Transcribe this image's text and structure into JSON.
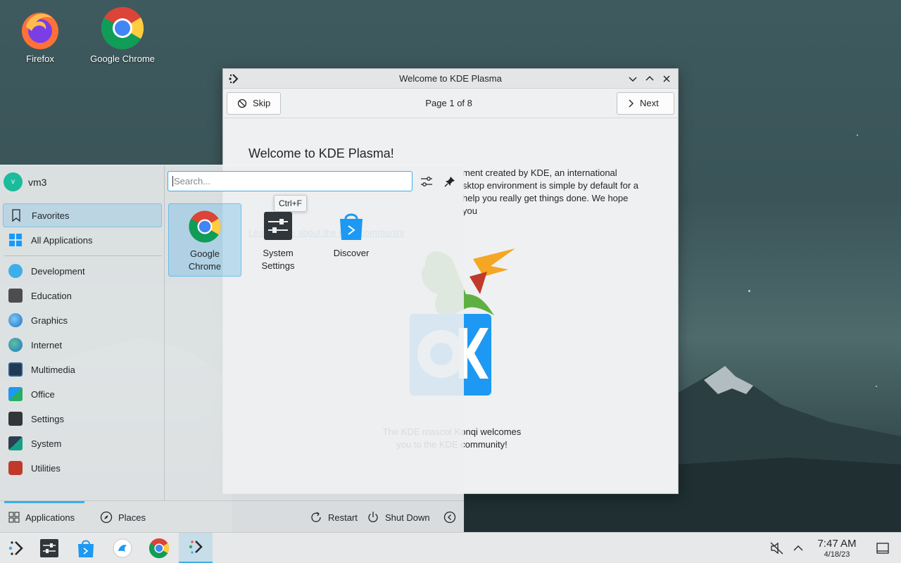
{
  "desktop": {
    "icons": [
      {
        "label": "Firefox",
        "icon": "firefox-icon"
      },
      {
        "label": "Google Chrome",
        "icon": "chrome-icon"
      }
    ]
  },
  "welcome_window": {
    "title": "Welcome to KDE Plasma",
    "skip_label": "Skip",
    "page_indicator": "Page 1 of 8",
    "next_label": "Next",
    "heading": "Welcome to KDE Plasma!",
    "paragraph_line1": "ment created by KDE, an international",
    "paragraph_line2": "sktop environment is simple by default for a",
    "paragraph_line3": "help you really get things done. We hope",
    "paragraph_line4": "you",
    "link_text": "Learn more about the KDE community",
    "caption": "The KDE mascot Konqi welcomes you to the KDE community!"
  },
  "launcher": {
    "user_name": "vm3",
    "user_initial": "v",
    "search_placeholder": "Search...",
    "tooltip": "Ctrl+F",
    "categories": [
      {
        "label": "Favorites",
        "icon": "bookmark-icon"
      },
      {
        "label": "All Applications",
        "icon": "grid-icon"
      },
      {
        "label": "Development",
        "icon": "development-icon"
      },
      {
        "label": "Education",
        "icon": "education-icon"
      },
      {
        "label": "Graphics",
        "icon": "graphics-icon"
      },
      {
        "label": "Internet",
        "icon": "internet-icon"
      },
      {
        "label": "Multimedia",
        "icon": "multimedia-icon"
      },
      {
        "label": "Office",
        "icon": "office-icon"
      },
      {
        "label": "Settings",
        "icon": "settings-icon"
      },
      {
        "label": "System",
        "icon": "system-icon"
      },
      {
        "label": "Utilities",
        "icon": "utilities-icon"
      }
    ],
    "apps": [
      {
        "label_line1": "Google",
        "label_line2": "Chrome"
      },
      {
        "label_line1": "System",
        "label_line2": "Settings"
      },
      {
        "label_line1": "Discover",
        "label_line2": ""
      }
    ],
    "footer": {
      "applications": "Applications",
      "places": "Places",
      "restart": "Restart",
      "shutdown": "Shut Down"
    }
  },
  "taskbar": {
    "time": "7:47 AM",
    "date": "4/18/23"
  },
  "colors": {
    "accent": "#3daee9",
    "window_bg": "#eff0f1",
    "text": "#232629"
  }
}
